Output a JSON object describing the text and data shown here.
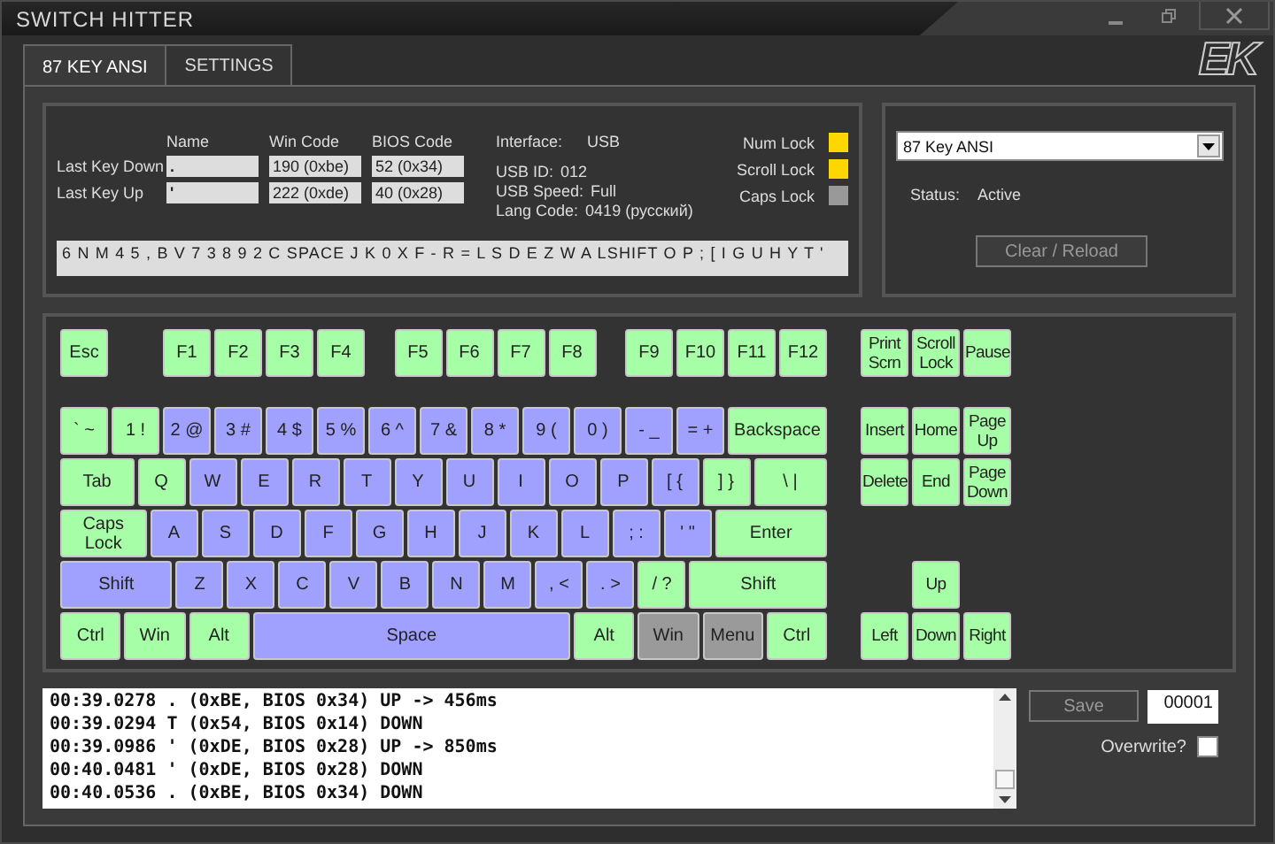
{
  "window": {
    "title": "SWITCH HITTER",
    "logo": "EK"
  },
  "tabs": [
    {
      "label": "87 KEY ANSI",
      "selected": true
    },
    {
      "label": "SETTINGS",
      "selected": false
    }
  ],
  "key_info": {
    "headers": [
      "Name",
      "Win Code",
      "BIOS Code"
    ],
    "rows": [
      {
        "label": "Last Key Down",
        "name": ".",
        "win_code": "190 (0xbe)",
        "bios_code": "52 (0x34)"
      },
      {
        "label": "Last Key Up",
        "name": "'",
        "win_code": "222 (0xde)",
        "bios_code": "40 (0x28)"
      }
    ]
  },
  "device_info": [
    {
      "label": "Interface:",
      "value": "USB"
    },
    {
      "label": "USB ID:",
      "value": "012"
    },
    {
      "label": "USB Speed:",
      "value": "Full"
    },
    {
      "label": "Lang Code:",
      "value": "0419 (русский)"
    }
  ],
  "locks": [
    {
      "label": "Num Lock",
      "on": true
    },
    {
      "label": "Scroll Lock",
      "on": true
    },
    {
      "label": "Caps Lock",
      "on": false
    }
  ],
  "key_sequence": "6 N M 4 5 , B V 7 3 8 9 2 C SPACE J K 0 X F - R = L S D E Z W A LSHIFT O P ; [ I G U H Y T '",
  "layout_select": {
    "value": "87 Key ANSI"
  },
  "status": {
    "label": "Status:",
    "value": "Active"
  },
  "clear_button": {
    "label": "Clear / Reload",
    "disabled": true
  },
  "keyboard": {
    "main_rows": [
      [
        {
          "label": "Esc",
          "color": "#a6ffa6"
        },
        {
          "label": "F1",
          "color": "#a6ffa6"
        },
        {
          "label": "F2",
          "color": "#a6ffa6"
        },
        {
          "label": "F3",
          "color": "#a6ffa6"
        },
        {
          "label": "F4",
          "color": "#a6ffa6"
        },
        {
          "label": "F5",
          "color": "#a6ffa6"
        },
        {
          "label": "F6",
          "color": "#a6ffa6"
        },
        {
          "label": "F7",
          "color": "#a6ffa6"
        },
        {
          "label": "F8",
          "color": "#a6ffa6"
        },
        {
          "label": "F9",
          "color": "#a6ffa6"
        },
        {
          "label": "F10",
          "color": "#a6ffa6"
        },
        {
          "label": "F11",
          "color": "#a6ffa6"
        },
        {
          "label": "F12",
          "color": "#a6ffa6"
        }
      ],
      [
        {
          "label": "` ~",
          "color": "#a6ffa6"
        },
        {
          "label": "1 !",
          "color": "#a6ffa6"
        },
        {
          "label": "2 @",
          "color": "#a0a0ff"
        },
        {
          "label": "3 #",
          "color": "#a0a0ff"
        },
        {
          "label": "4 $",
          "color": "#a0a0ff"
        },
        {
          "label": "5 %",
          "color": "#a0a0ff"
        },
        {
          "label": "6 ^",
          "color": "#a0a0ff"
        },
        {
          "label": "7 &",
          "color": "#a0a0ff"
        },
        {
          "label": "8 *",
          "color": "#a0a0ff"
        },
        {
          "label": "9 (",
          "color": "#a0a0ff"
        },
        {
          "label": "0 )",
          "color": "#a0a0ff"
        },
        {
          "label": "- _",
          "color": "#a0a0ff"
        },
        {
          "label": "= +",
          "color": "#a0a0ff"
        },
        {
          "label": "Backspace",
          "color": "#a6ffa6"
        }
      ],
      [
        {
          "label": "Tab",
          "color": "#a6ffa6"
        },
        {
          "label": "Q",
          "color": "#a6ffa6"
        },
        {
          "label": "W",
          "color": "#a0a0ff"
        },
        {
          "label": "E",
          "color": "#a0a0ff"
        },
        {
          "label": "R",
          "color": "#a0a0ff"
        },
        {
          "label": "T",
          "color": "#a0a0ff"
        },
        {
          "label": "Y",
          "color": "#a0a0ff"
        },
        {
          "label": "U",
          "color": "#a0a0ff"
        },
        {
          "label": "I",
          "color": "#a0a0ff"
        },
        {
          "label": "O",
          "color": "#a0a0ff"
        },
        {
          "label": "P",
          "color": "#a0a0ff"
        },
        {
          "label": "[ {",
          "color": "#a0a0ff"
        },
        {
          "label": "] }",
          "color": "#a6ffa6"
        },
        {
          "label": "\\ |",
          "color": "#a6ffa6"
        }
      ],
      [
        {
          "label": "Caps Lock",
          "color": "#a6ffa6"
        },
        {
          "label": "A",
          "color": "#a0a0ff"
        },
        {
          "label": "S",
          "color": "#a0a0ff"
        },
        {
          "label": "D",
          "color": "#a0a0ff"
        },
        {
          "label": "F",
          "color": "#a0a0ff"
        },
        {
          "label": "G",
          "color": "#a0a0ff"
        },
        {
          "label": "H",
          "color": "#a0a0ff"
        },
        {
          "label": "J",
          "color": "#a0a0ff"
        },
        {
          "label": "K",
          "color": "#a0a0ff"
        },
        {
          "label": "L",
          "color": "#a0a0ff"
        },
        {
          "label": "; :",
          "color": "#a0a0ff"
        },
        {
          "label": "' \"",
          "color": "#a0a0ff"
        },
        {
          "label": "Enter",
          "color": "#a6ffa6"
        }
      ],
      [
        {
          "label": "Shift",
          "color": "#a0a0ff"
        },
        {
          "label": "Z",
          "color": "#a0a0ff"
        },
        {
          "label": "X",
          "color": "#a0a0ff"
        },
        {
          "label": "C",
          "color": "#a0a0ff"
        },
        {
          "label": "V",
          "color": "#a0a0ff"
        },
        {
          "label": "B",
          "color": "#a0a0ff"
        },
        {
          "label": "N",
          "color": "#a0a0ff"
        },
        {
          "label": "M",
          "color": "#a0a0ff"
        },
        {
          "label": ", <",
          "color": "#a0a0ff"
        },
        {
          "label": ". >",
          "color": "#a0a0ff"
        },
        {
          "label": "/ ?",
          "color": "#a6ffa6"
        },
        {
          "label": "Shift",
          "color": "#a6ffa6"
        }
      ],
      [
        {
          "label": "Ctrl",
          "color": "#a6ffa6"
        },
        {
          "label": "Win",
          "color": "#a6ffa6"
        },
        {
          "label": "Alt",
          "color": "#a6ffa6"
        },
        {
          "label": "Space",
          "color": "#a0a0ff"
        },
        {
          "label": "Alt",
          "color": "#a6ffa6"
        },
        {
          "label": "Win",
          "color": "#9a9a9a"
        },
        {
          "label": "Menu",
          "color": "#9a9a9a"
        },
        {
          "label": "Ctrl",
          "color": "#a6ffa6"
        }
      ]
    ],
    "nav_rows": [
      [
        {
          "label": "Print Scrn",
          "color": "#a6ffa6"
        },
        {
          "label": "Scroll Lock",
          "color": "#a6ffa6"
        },
        {
          "label": "Pause",
          "color": "#a6ffa6"
        }
      ],
      [
        {
          "label": "Insert",
          "color": "#a6ffa6"
        },
        {
          "label": "Home",
          "color": "#a6ffa6"
        },
        {
          "label": "Page Up",
          "color": "#a6ffa6"
        }
      ],
      [
        {
          "label": "Delete",
          "color": "#a6ffa6"
        },
        {
          "label": "End",
          "color": "#a6ffa6"
        },
        {
          "label": "Page Down",
          "color": "#a6ffa6"
        }
      ],
      [
        {
          "label": "Up",
          "color": "#a6ffa6"
        }
      ],
      [
        {
          "label": "Left",
          "color": "#a6ffa6"
        },
        {
          "label": "Down",
          "color": "#a6ffa6"
        },
        {
          "label": "Right",
          "color": "#a6ffa6"
        }
      ]
    ]
  },
  "log": [
    "00:39.0278 . (0xBE, BIOS 0x34) UP -> 456ms",
    "00:39.0294 T (0x54, BIOS 0x14) DOWN",
    "00:39.0986 ' (0xDE, BIOS 0x28) UP -> 850ms",
    "00:40.0481 ' (0xDE, BIOS 0x28) DOWN",
    "00:40.0536 . (0xBE, BIOS 0x34) DOWN"
  ],
  "save_button": {
    "label": "Save",
    "disabled": true
  },
  "file_number": "00001",
  "overwrite": {
    "label": "Overwrite?",
    "checked": false
  }
}
